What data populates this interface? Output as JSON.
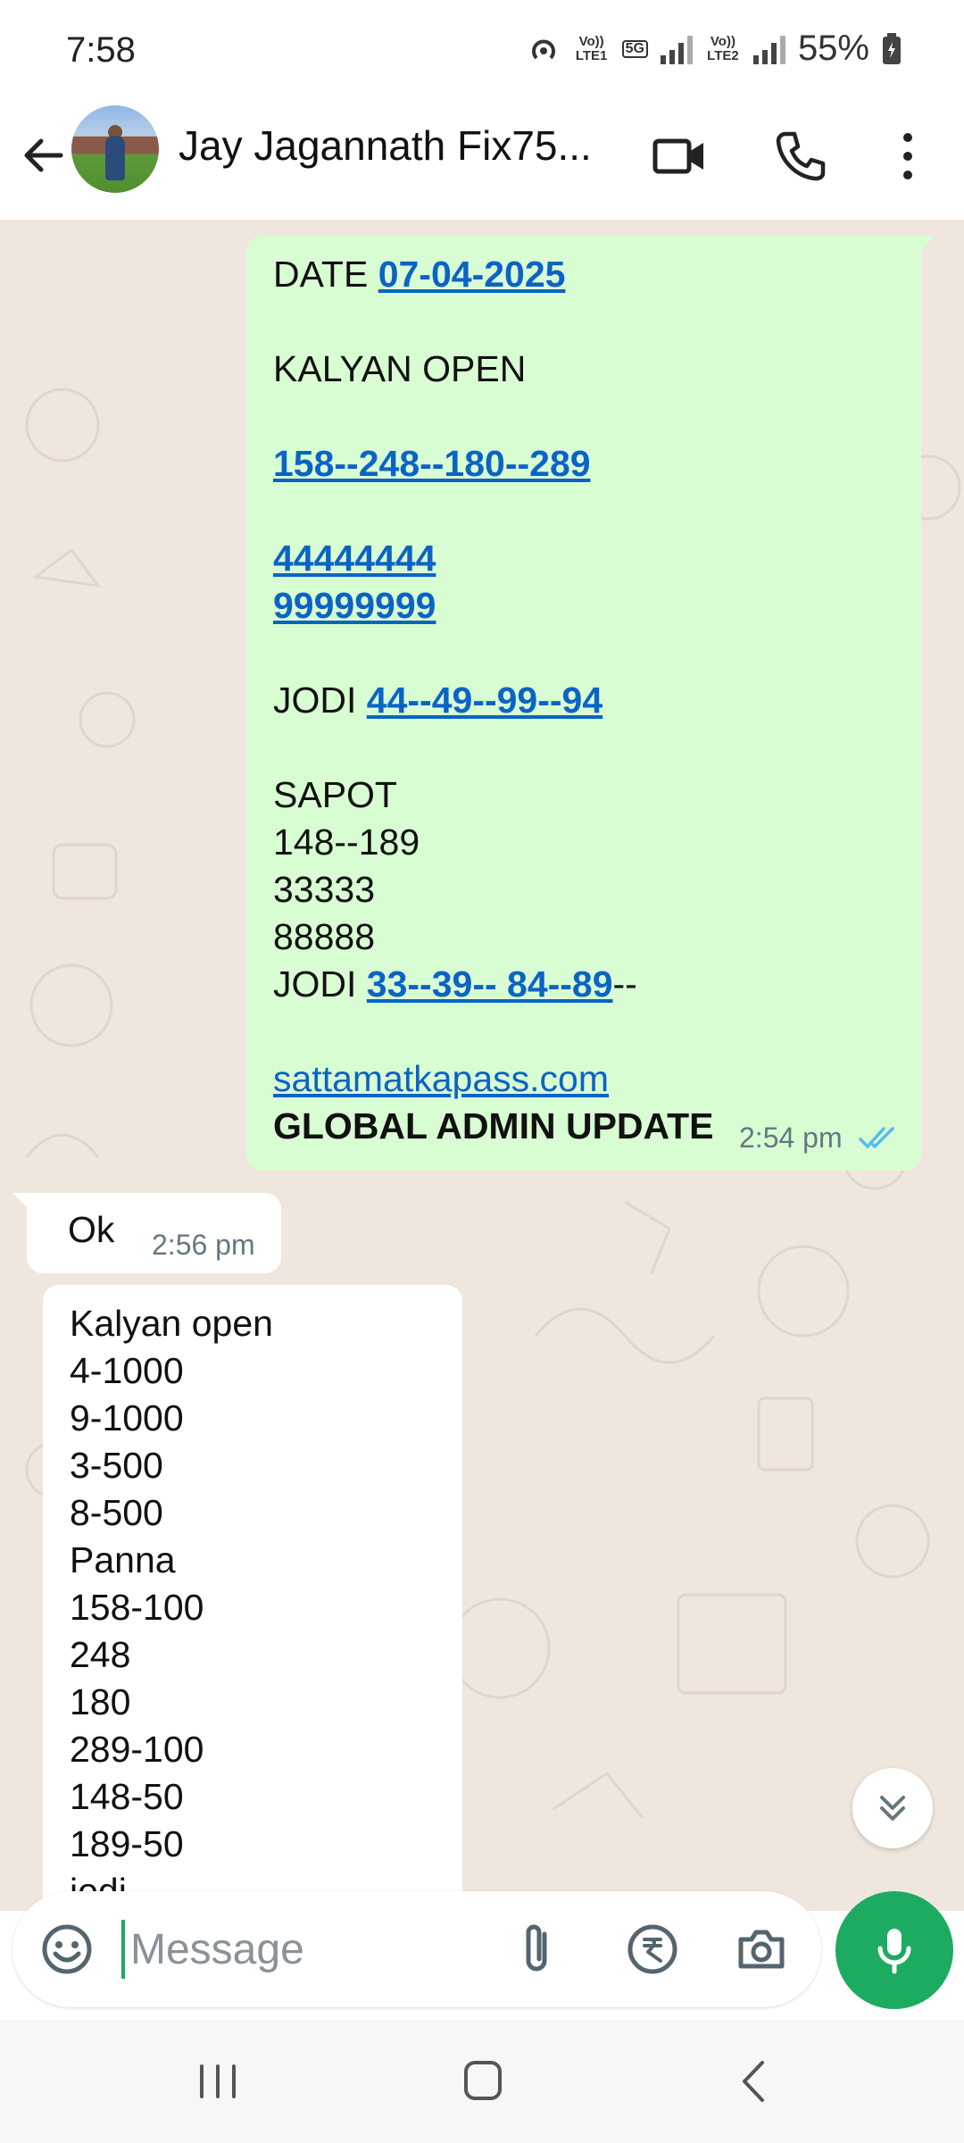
{
  "status_bar": {
    "time": "7:58",
    "sim1_label": "Vo)) LTE1",
    "net_label": "5G",
    "sim2_label": "Vo)) LTE2",
    "battery": "55%"
  },
  "header": {
    "contact_name": "Jay Jagannath Fix75...",
    "icons": [
      "back-arrow-icon",
      "video-call-icon",
      "voice-call-icon",
      "more-vertical-icon"
    ]
  },
  "messages": {
    "outgoing": {
      "date_label": "DATE ",
      "date_link": "07-04-2025",
      "kalyan_open": "KALYAN  OPEN",
      "panna_link": "158--248--180--289",
      "num_link_1": "44444444",
      "num_link_2": "99999999",
      "jodi_label": "JODI ",
      "jodi_link": "44--49--99--94",
      "sapot": "SAPOT",
      "sapot_1": "148--189",
      "sapot_2": "33333",
      "sapot_3": "88888",
      "jodi2_label": "JODI ",
      "jodi2_link": "33--39-- 84--89",
      "jodi2_suffix": "--",
      "site_link": "sattamatkapass.com",
      "footer": "GLOBAL ADMIN UPDATE",
      "time": "2:54 pm",
      "status": "read"
    },
    "ok": {
      "text": "Ok",
      "time": "2:56 pm"
    },
    "list": {
      "lines": [
        "Kalyan open",
        "4-1000",
        "9-1000",
        "3-500",
        "8-500",
        "Panna",
        "158-100",
        "248",
        "180",
        "289-100",
        "148-50",
        "189-50",
        "jodi"
      ]
    }
  },
  "composer": {
    "placeholder": "Message",
    "icons": [
      "emoji-icon",
      "attach-icon",
      "rupee-payment-icon",
      "camera-icon",
      "mic-icon"
    ]
  },
  "nav": {
    "icons": [
      "recent-apps-icon",
      "home-icon",
      "back-icon"
    ]
  },
  "colors": {
    "outgoing_bubble": "#d9fdd3",
    "incoming_bubble": "#ffffff",
    "chat_bg": "#efe7dd",
    "link": "#0b63c5",
    "accent_green": "#1daa61",
    "read_ticks": "#53bdeb"
  }
}
